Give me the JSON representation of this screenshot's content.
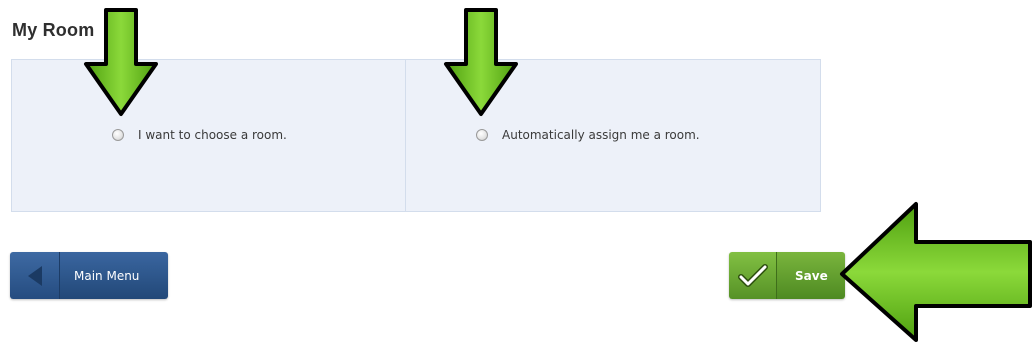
{
  "page": {
    "title": "My Room"
  },
  "room_options": {
    "choose": {
      "label": "I want to choose a room.",
      "selected": false
    },
    "auto": {
      "label": "Automatically assign me a room.",
      "selected": false
    }
  },
  "buttons": {
    "main_menu": {
      "label": "Main Menu",
      "icon": "back-arrow-icon"
    },
    "save": {
      "label": "Save",
      "icon": "checkmark-icon"
    }
  },
  "annotations": {
    "pointer_arrow_color": "#6cc11c",
    "pointer_arrow_outline": "#000000"
  },
  "colors": {
    "panel_bg": "#edf1f9",
    "main_menu_blue": "#2f5a92",
    "save_green": "#68a530"
  }
}
